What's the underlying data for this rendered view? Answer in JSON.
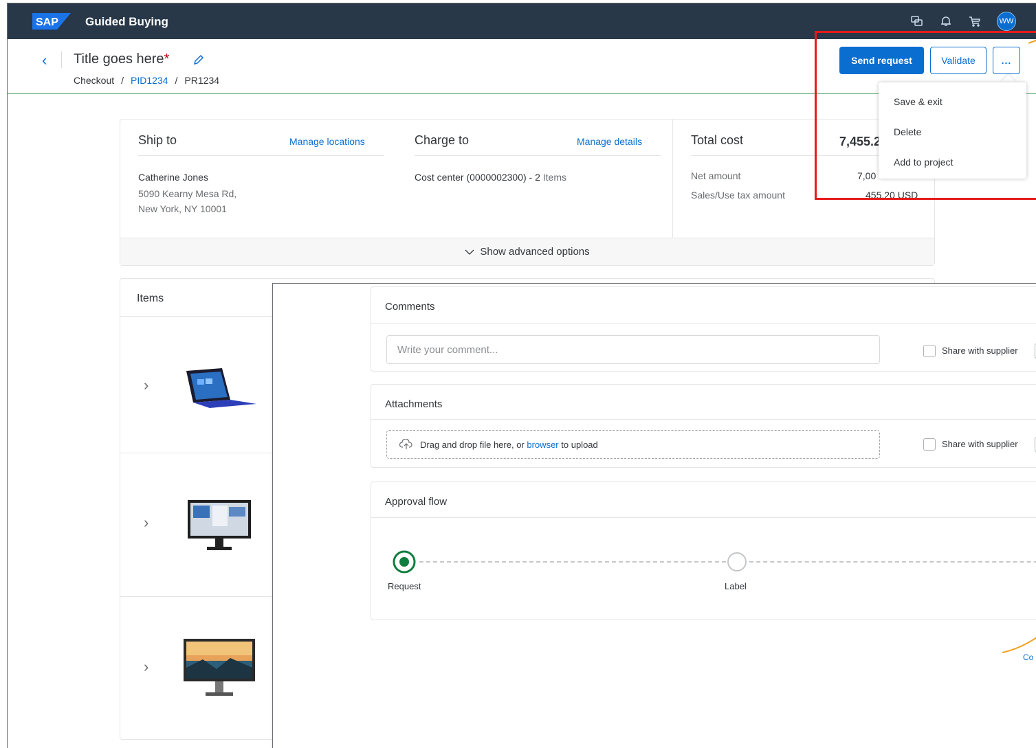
{
  "shell": {
    "logo_text": "SAP",
    "title": "Guided Buying",
    "avatar_initials": "WW",
    "icons": [
      "feedback-icon",
      "bell-icon",
      "cart-icon"
    ]
  },
  "header": {
    "title": "Title goes here",
    "required_mark": "*",
    "breadcrumb": [
      "Checkout",
      "PID1234",
      "PR1234"
    ],
    "breadcrumb_sep": "/",
    "send_label": "Send request",
    "validate_label": "Validate",
    "more_label": "..."
  },
  "menu": {
    "items": [
      "Save & exit",
      "Delete",
      "Add to project"
    ]
  },
  "summary": {
    "ship_to": {
      "title": "Ship to",
      "link": "Manage locations",
      "name": "Catherine Jones",
      "address1": "5090 Kearny Mesa Rd,",
      "address2": "New York, NY 10001"
    },
    "charge_to": {
      "title": "Charge to",
      "link": "Manage details",
      "label": "Cost center (0000002300) - 2",
      "suffix": "Items"
    },
    "total": {
      "title": "Total cost",
      "value": "7,455.2",
      "net_label": "Net amount",
      "net_value": "7,00",
      "tax_label": "Sales/Use tax amount",
      "tax_value": "455.20 USD"
    },
    "advanced": "Show advanced options"
  },
  "items": {
    "title": "Items"
  },
  "overlay": {
    "comments": {
      "title": "Comments",
      "placeholder": "Write your comment...",
      "share": "Share with supplier"
    },
    "attachments": {
      "title": "Attachments",
      "drop_prefix": "Drag and drop file here, or",
      "drop_link": "browser",
      "drop_suffix": "to upload",
      "share": "Share with supplier"
    },
    "approval": {
      "title": "Approval flow",
      "steps": [
        "Request",
        "Label"
      ]
    },
    "corner_text": "Co"
  },
  "colors": {
    "shell_bg": "#283849",
    "accent": "#0a6ed1",
    "highlight": "#e51a1a",
    "success": "#107e3e"
  }
}
